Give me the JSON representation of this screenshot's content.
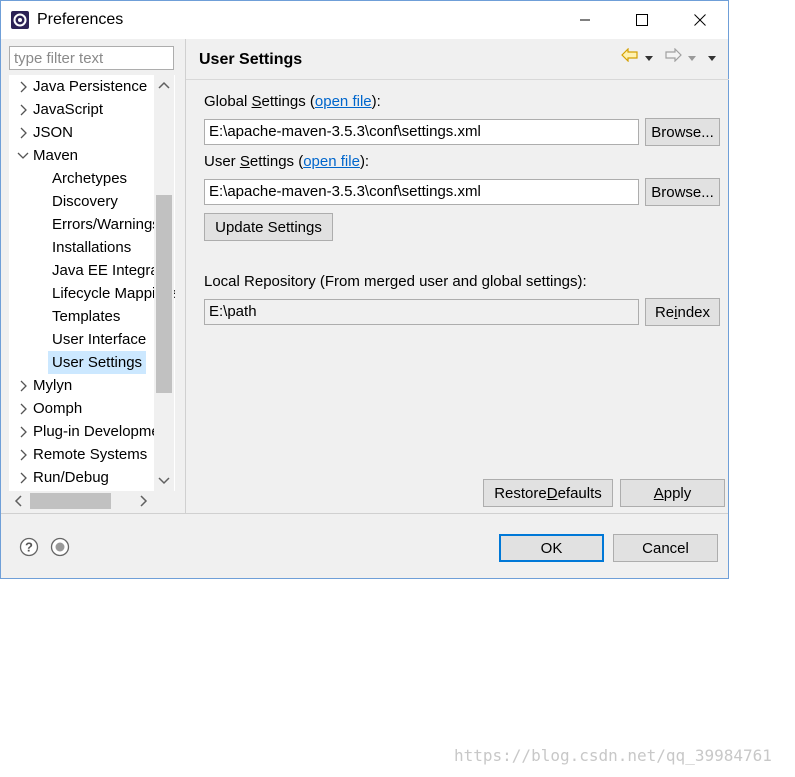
{
  "window": {
    "title": "Preferences"
  },
  "sidebar": {
    "filter_placeholder": "type filter text",
    "items": [
      {
        "label": "Java Persistence",
        "level": 0,
        "expanded": false
      },
      {
        "label": "JavaScript",
        "level": 0,
        "expanded": false
      },
      {
        "label": "JSON",
        "level": 0,
        "expanded": false
      },
      {
        "label": "Maven",
        "level": 0,
        "expanded": true
      },
      {
        "label": "Archetypes",
        "level": 1
      },
      {
        "label": "Discovery",
        "level": 1
      },
      {
        "label": "Errors/Warnings",
        "level": 1
      },
      {
        "label": "Installations",
        "level": 1
      },
      {
        "label": "Java EE Integration",
        "level": 1
      },
      {
        "label": "Lifecycle Mappings",
        "level": 1
      },
      {
        "label": "Templates",
        "level": 1
      },
      {
        "label": "User Interface",
        "level": 1
      },
      {
        "label": "User Settings",
        "level": 1,
        "selected": true
      },
      {
        "label": "Mylyn",
        "level": 0,
        "expanded": false
      },
      {
        "label": "Oomph",
        "level": 0,
        "expanded": false
      },
      {
        "label": "Plug-in Development",
        "level": 0,
        "expanded": false
      },
      {
        "label": "Remote Systems",
        "level": 0,
        "expanded": false
      },
      {
        "label": "Run/Debug",
        "level": 0,
        "expanded": false
      }
    ]
  },
  "page": {
    "title": "User Settings",
    "global_settings": {
      "label_prefix": "Global ",
      "label_mnemonic": "S",
      "label_rest": "ettings (",
      "link": "open file",
      "label_suffix": "):",
      "value": "E:\\apache-maven-3.5.3\\conf\\settings.xml",
      "browse_label": "Browse..."
    },
    "user_settings": {
      "label_prefix": "User ",
      "label_mnemonic": "S",
      "label_rest": "ettings (",
      "link": "open file",
      "label_suffix": "):",
      "value": "E:\\apache-maven-3.5.3\\conf\\settings.xml",
      "browse_label": "Browse..."
    },
    "update_settings_label": "Update Settings",
    "local_repo": {
      "label": "Local Repository (From merged user and global settings):",
      "value": "E:\\path",
      "reindex_prefix": "Re",
      "reindex_mnemonic": "i",
      "reindex_rest": "ndex"
    },
    "restore_defaults_prefix": "Restore ",
    "restore_defaults_mnemonic": "D",
    "restore_defaults_rest": "efaults",
    "apply_mnemonic": "A",
    "apply_rest": "pply"
  },
  "footer": {
    "ok_label": "OK",
    "cancel_label": "Cancel"
  },
  "watermark": "https://blog.csdn.net/qq_39984761",
  "colors": {
    "accent": "#0078d7",
    "link": "#0066cc",
    "selection": "#cce8ff",
    "nav_arrow": "#e8b400"
  }
}
